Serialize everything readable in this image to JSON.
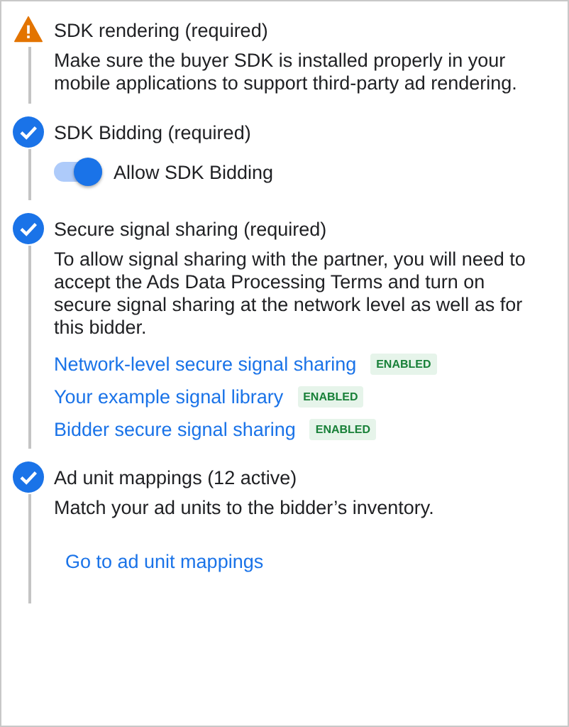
{
  "steps": [
    {
      "kind": "warning",
      "title": "SDK rendering (required)",
      "description": "Make sure the buyer SDK is installed properly in your mobile applications to support third-party ad rendering."
    },
    {
      "kind": "done",
      "title": "SDK Bidding (required)",
      "toggle": {
        "label": "Allow SDK Bidding",
        "on": true
      }
    },
    {
      "kind": "done",
      "title": "Secure signal sharing (required)",
      "description": "To allow signal sharing with the partner, you will need to accept the Ads Data Processing Terms and turn on secure signal sharing at the network level as well as for this bidder.",
      "links": [
        {
          "label": "Network-level secure signal sharing",
          "badge": "ENABLED"
        },
        {
          "label": "Your example signal library",
          "badge": "ENABLED"
        },
        {
          "label": "Bidder secure signal sharing",
          "badge": "ENABLED"
        }
      ]
    },
    {
      "kind": "done",
      "title": "Ad unit mappings (12 active)",
      "description": "Match your ad units to the bidder’s inventory.",
      "action": "Go to ad unit mappings"
    }
  ]
}
